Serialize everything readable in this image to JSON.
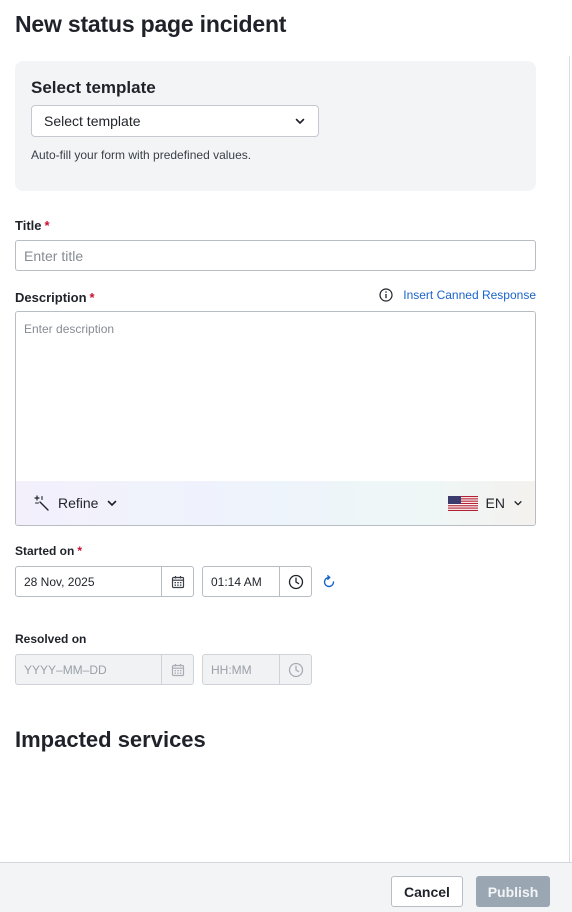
{
  "page": {
    "title": "New status page incident"
  },
  "template": {
    "heading": "Select template",
    "select_value": "Select template",
    "hint": "Auto-fill your form with predefined values."
  },
  "title_field": {
    "label": "Title",
    "required_mark": "*",
    "placeholder": "Enter title",
    "value": ""
  },
  "description_field": {
    "label": "Description",
    "required_mark": "*",
    "placeholder": "Enter description",
    "value": "",
    "canned_link": "Insert Canned Response",
    "refine_label": "Refine",
    "language": "EN"
  },
  "started_on": {
    "label": "Started on",
    "required_mark": "*",
    "date": "28 Nov, 2025",
    "time": "01:14 AM"
  },
  "resolved_on": {
    "label": "Resolved on",
    "date_placeholder": "YYYY–MM–DD",
    "time_placeholder": "HH:MM"
  },
  "impacted": {
    "heading": "Impacted services"
  },
  "footer": {
    "cancel_label": "Cancel",
    "publish_label": "Publish"
  },
  "colors": {
    "link": "#1a64c9",
    "required": "#c8102e",
    "publish_disabled": "#9aa6b2"
  },
  "icons": [
    "chevron-down-icon",
    "info-icon",
    "magic-wand-icon",
    "us-flag-icon",
    "calendar-icon",
    "clock-icon",
    "reset-icon"
  ]
}
